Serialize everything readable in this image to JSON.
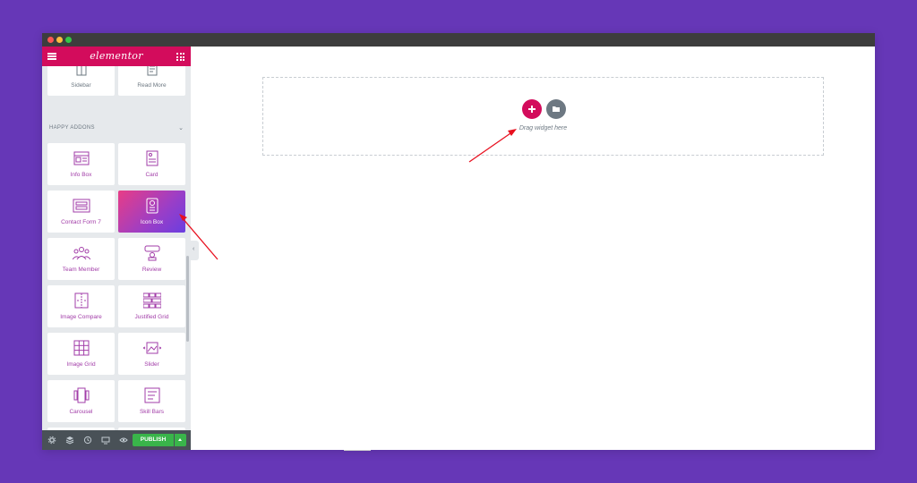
{
  "app": {
    "logo": "elementor"
  },
  "widgets": {
    "top_row": [
      {
        "label": "Sidebar",
        "icon": "sidebar-icon"
      },
      {
        "label": "Read More",
        "icon": "read-more-icon"
      }
    ],
    "section_title": "HAPPY ADDONS",
    "items": [
      {
        "label": "Info Box",
        "icon": "info-box-icon"
      },
      {
        "label": "Card",
        "icon": "card-icon"
      },
      {
        "label": "Contact Form 7",
        "icon": "contact-form-icon"
      },
      {
        "label": "Icon Box",
        "icon": "icon-box-icon",
        "active": true
      },
      {
        "label": "Team Member",
        "icon": "team-member-icon"
      },
      {
        "label": "Review",
        "icon": "review-icon"
      },
      {
        "label": "Image Compare",
        "icon": "image-compare-icon"
      },
      {
        "label": "Justified Grid",
        "icon": "justified-grid-icon"
      },
      {
        "label": "Image Grid",
        "icon": "image-grid-icon"
      },
      {
        "label": "Slider",
        "icon": "slider-icon"
      },
      {
        "label": "Carousel",
        "icon": "carousel-icon"
      },
      {
        "label": "Skill Bars",
        "icon": "skill-bars-icon"
      }
    ]
  },
  "footer": {
    "publish_label": "PUBLISH",
    "icons": [
      "settings-icon",
      "navigator-icon",
      "history-icon",
      "responsive-icon",
      "preview-icon"
    ]
  },
  "canvas": {
    "drag_text": "Drag widget here"
  },
  "colors": {
    "brand": "#d30c5c",
    "background": "#6637b7",
    "publish": "#39b54a",
    "active_gradient_start": "#e83d86",
    "active_gradient_end": "#6a3ee0"
  }
}
